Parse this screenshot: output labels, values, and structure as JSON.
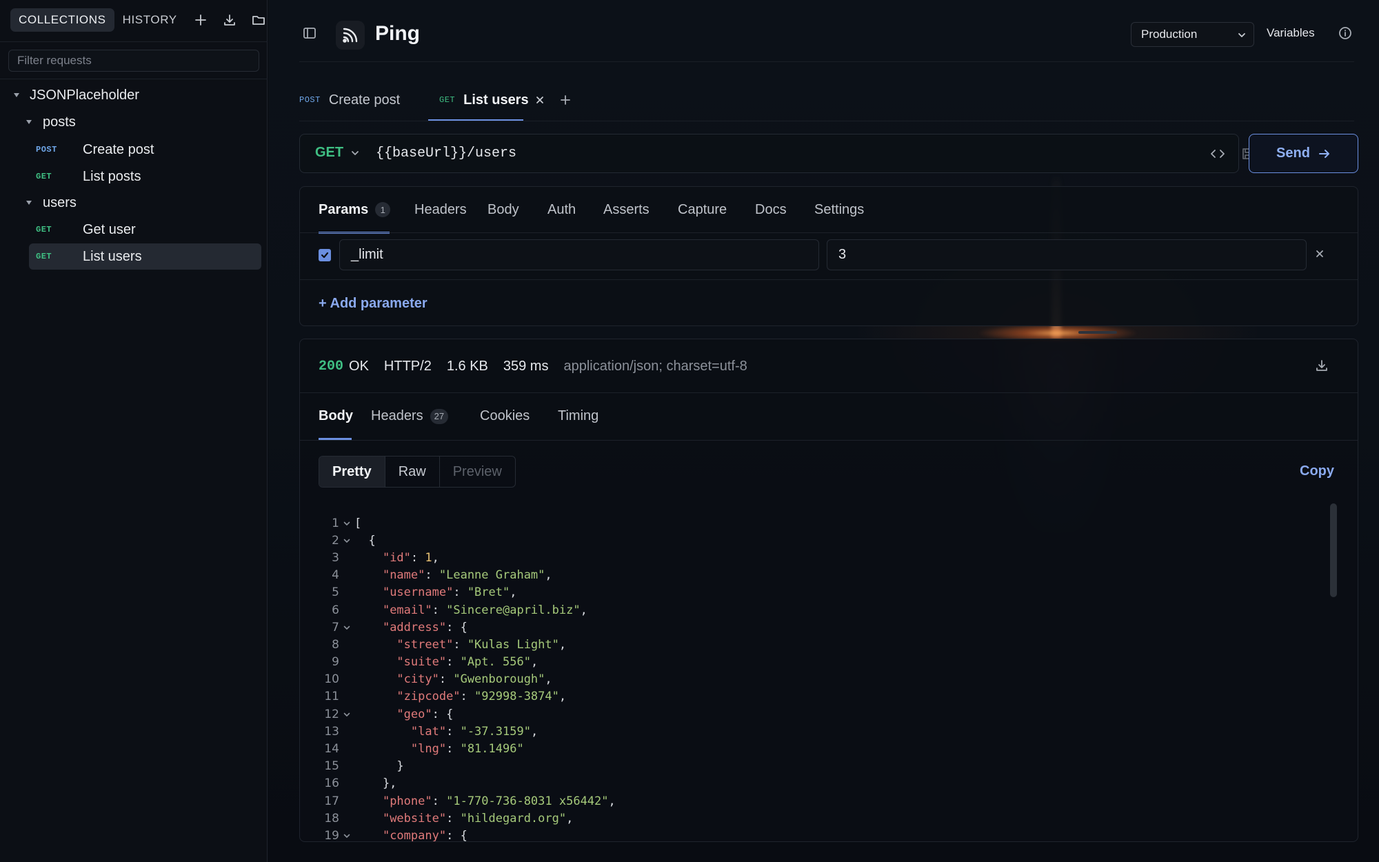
{
  "sidebar": {
    "tabs": [
      {
        "label": "COLLECTIONS",
        "active": true
      },
      {
        "label": "HISTORY",
        "active": false
      }
    ],
    "filter_placeholder": "Filter requests",
    "collection": {
      "name": "JSONPlaceholder",
      "folders": [
        {
          "name": "posts",
          "requests": [
            {
              "method": "POST",
              "name": "Create post"
            },
            {
              "method": "GET",
              "name": "List posts"
            }
          ]
        },
        {
          "name": "users",
          "requests": [
            {
              "method": "GET",
              "name": "Get user"
            },
            {
              "method": "GET",
              "name": "List users",
              "active": true
            }
          ]
        }
      ]
    }
  },
  "header": {
    "title": "Ping",
    "environment": "Production",
    "variables_label": "Variables"
  },
  "tabs": [
    {
      "method": "POST",
      "label": "Create post",
      "active": false
    },
    {
      "method": "GET",
      "label": "List users",
      "active": true
    }
  ],
  "request": {
    "method": "GET",
    "url": "{{baseUrl}}/users",
    "send_label": "Send",
    "subtabs": [
      {
        "label": "Params",
        "badge": "1",
        "active": true
      },
      {
        "label": "Headers"
      },
      {
        "label": "Body"
      },
      {
        "label": "Auth"
      },
      {
        "label": "Asserts"
      },
      {
        "label": "Capture"
      },
      {
        "label": "Docs"
      },
      {
        "label": "Settings"
      }
    ],
    "params": [
      {
        "enabled": true,
        "key": "_limit",
        "value": "3"
      }
    ],
    "add_param_label": "+ Add parameter"
  },
  "response": {
    "status_code": "200",
    "status_text": "OK",
    "protocol": "HTTP/2",
    "size": "1.6 KB",
    "time": "359 ms",
    "content_type": "application/json; charset=utf-8",
    "tabs": [
      {
        "label": "Body",
        "active": true
      },
      {
        "label": "Headers",
        "badge": "27"
      },
      {
        "label": "Cookies"
      },
      {
        "label": "Timing"
      }
    ],
    "views": [
      {
        "label": "Pretty",
        "active": true
      },
      {
        "label": "Raw"
      },
      {
        "label": "Preview",
        "disabled": true
      }
    ],
    "copy_label": "Copy",
    "code_lines": [
      {
        "n": "1",
        "fold": true,
        "text": "["
      },
      {
        "n": "2",
        "fold": true,
        "text": "  {"
      },
      {
        "n": "3",
        "text": "    \"id\": 1,"
      },
      {
        "n": "4",
        "text": "    \"name\": \"Leanne Graham\","
      },
      {
        "n": "5",
        "text": "    \"username\": \"Bret\","
      },
      {
        "n": "6",
        "text": "    \"email\": \"Sincere@april.biz\","
      },
      {
        "n": "7",
        "fold": true,
        "text": "    \"address\": {"
      },
      {
        "n": "8",
        "text": "      \"street\": \"Kulas Light\","
      },
      {
        "n": "9",
        "text": "      \"suite\": \"Apt. 556\","
      },
      {
        "n": "10",
        "text": "      \"city\": \"Gwenborough\","
      },
      {
        "n": "11",
        "text": "      \"zipcode\": \"92998-3874\","
      },
      {
        "n": "12",
        "fold": true,
        "text": "      \"geo\": {"
      },
      {
        "n": "13",
        "text": "        \"lat\": \"-37.3159\","
      },
      {
        "n": "14",
        "text": "        \"lng\": \"81.1496\""
      },
      {
        "n": "15",
        "text": "      }"
      },
      {
        "n": "16",
        "text": "    },"
      },
      {
        "n": "17",
        "text": "    \"phone\": \"1-770-736-8031 x56442\","
      },
      {
        "n": "18",
        "text": "    \"website\": \"hildegard.org\","
      },
      {
        "n": "19",
        "fold": true,
        "text": "    \"company\": {"
      }
    ]
  },
  "colors": {
    "accent": "#6b8fe0",
    "get": "#3fbf83",
    "post": "#6fa6e8",
    "json_key": "#e07a7a",
    "json_string": "#a5c97a",
    "json_number": "#e8c173"
  }
}
